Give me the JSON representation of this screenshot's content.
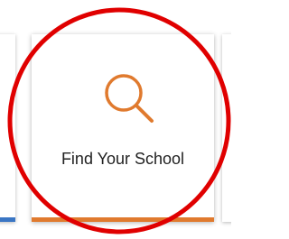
{
  "cards": {
    "main": {
      "label": "Find Your School",
      "icon": "search-icon",
      "accent_color": "#e07a2e"
    },
    "left": {
      "accent_color": "#3a76c4"
    }
  },
  "annotation": {
    "shape": "circle",
    "color": "#e00000"
  }
}
